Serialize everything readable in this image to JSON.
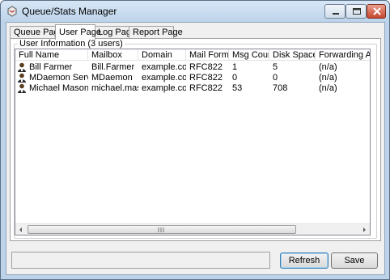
{
  "window": {
    "title": "Queue/Stats Manager"
  },
  "tabs": [
    {
      "label": "Queue Page",
      "active": false
    },
    {
      "label": "User Page",
      "active": true
    },
    {
      "label": "Log Page",
      "active": false
    },
    {
      "label": "Report Page",
      "active": false
    }
  ],
  "group": {
    "label": "User Information  (3 users)"
  },
  "table": {
    "columns": [
      "Full Name",
      "Mailbox",
      "Domain",
      "Mail Format",
      "Msg Count",
      "Disk Space",
      "Forwarding Addre"
    ],
    "rows": [
      [
        "Bill Farmer",
        "Bill.Farmer",
        "example.com",
        "RFC822",
        "1",
        "5",
        "(n/a)"
      ],
      [
        "MDaemon Server",
        "MDaemon",
        "example.com",
        "RFC822",
        "0",
        "0",
        "(n/a)"
      ],
      [
        "Michael Mason",
        "michael.mason",
        "example.com",
        "RFC822",
        "53",
        "708",
        "(n/a)"
      ]
    ],
    "row_icon": "user-icon"
  },
  "buttons": {
    "refresh": "Refresh",
    "save": "Save"
  },
  "colors": {
    "frame": "#bcd3ea",
    "close": "#c7472d",
    "default_button": "#3c7fb1"
  }
}
